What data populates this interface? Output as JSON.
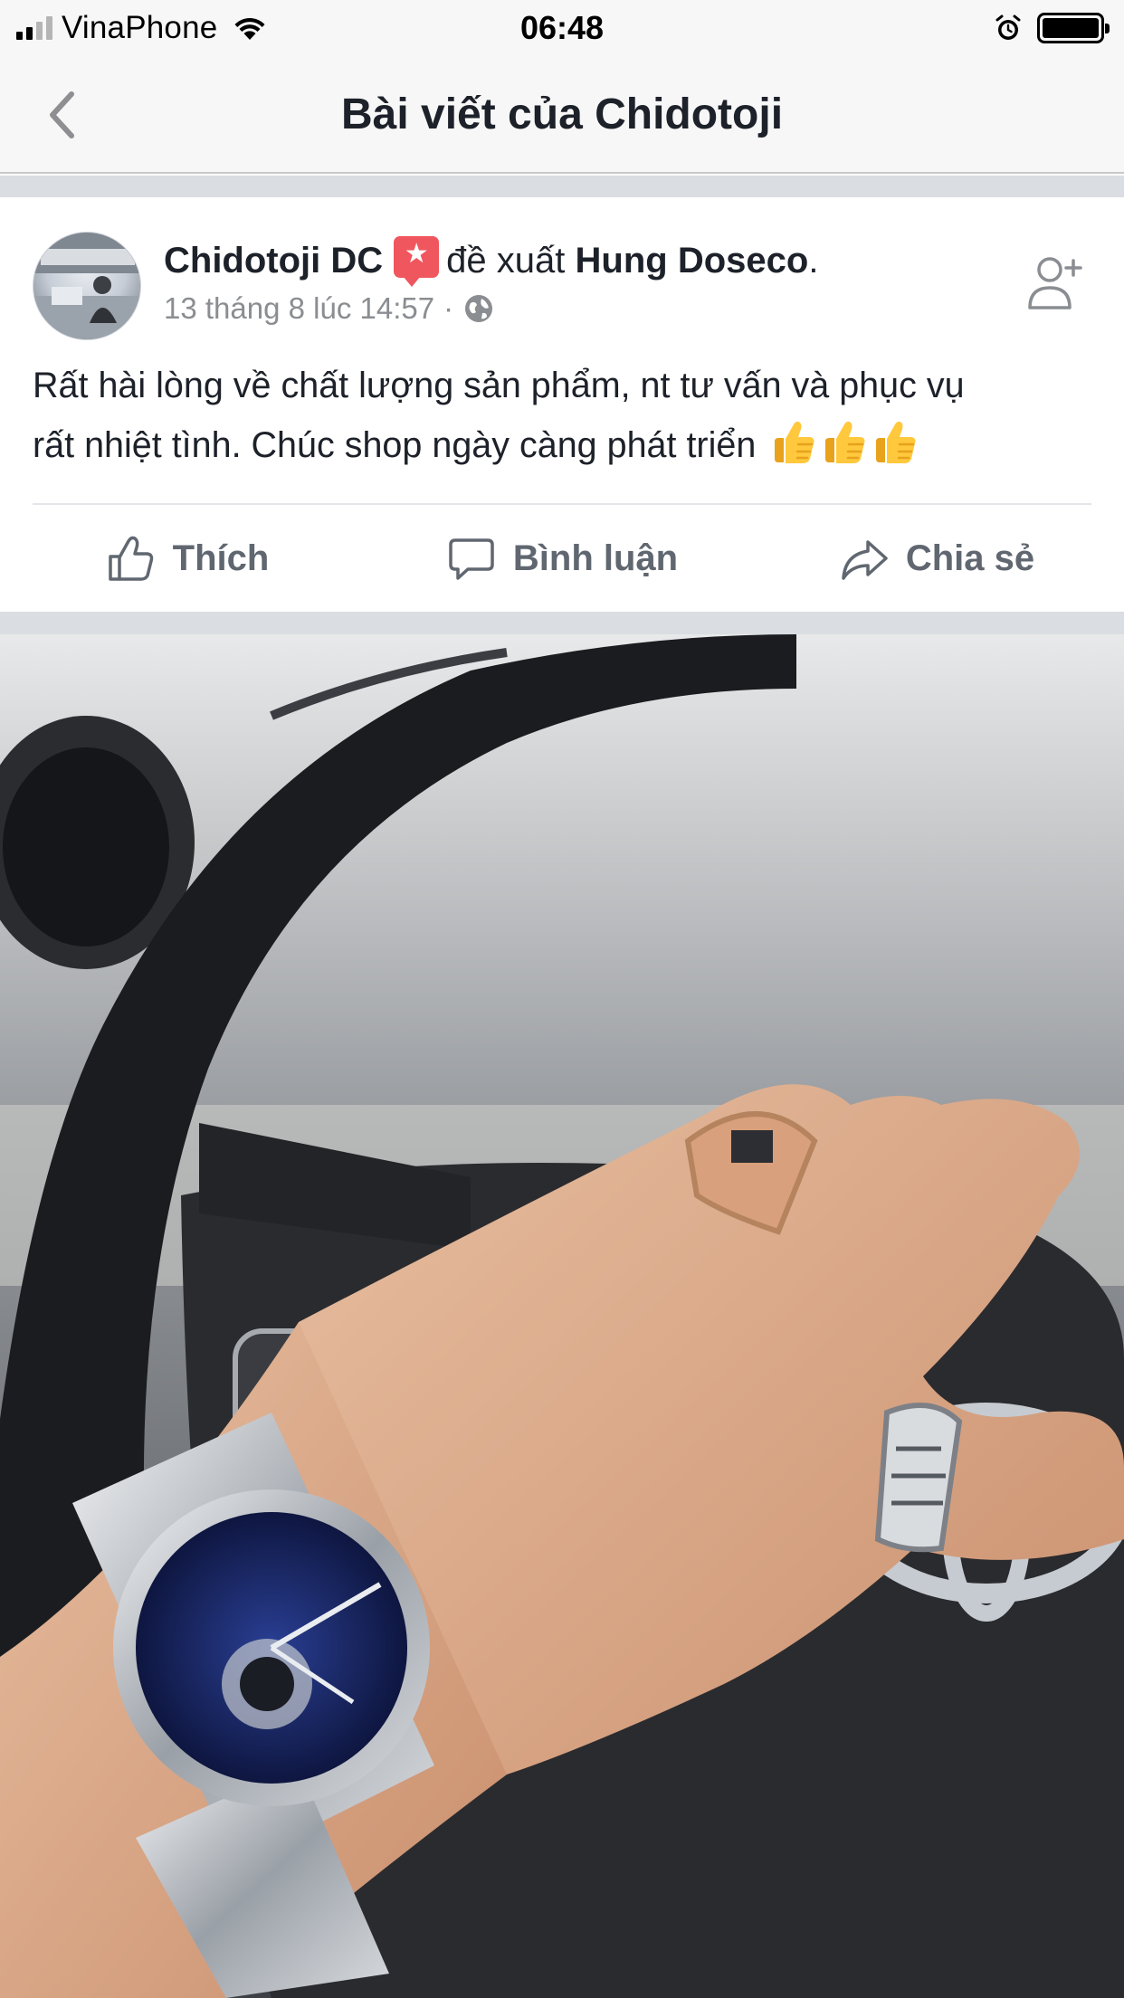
{
  "status_bar": {
    "carrier": "VinaPhone",
    "time": "06:48",
    "battery_level": 1.0
  },
  "nav": {
    "title": "Bài viết của Chidotoji"
  },
  "post": {
    "author": "Chidotoji DC",
    "verb": "đề xuất",
    "target": "Hung Doseco",
    "target_suffix": ".",
    "timestamp": "13 tháng 8 lúc 14:57",
    "separator": "·",
    "text_line1": "Rất hài lòng về chất lượng sản phẩm, nt tư vấn và phục vụ",
    "text_line2": "rất nhiệt tình. Chúc shop ngày càng phát triển",
    "emoji_count": 3
  },
  "actions": {
    "like": "Thích",
    "comment": "Bình luận",
    "share": "Chia sẻ"
  },
  "colors": {
    "bar_bg": "#f7f7f7",
    "text": "#1d2129",
    "meta": "#8a8d91",
    "action": "#606770",
    "badge": "#f0565d"
  }
}
